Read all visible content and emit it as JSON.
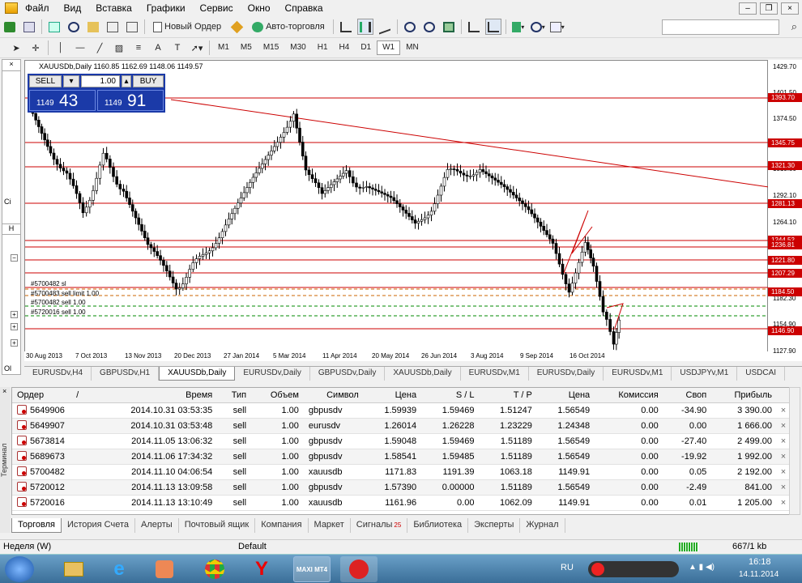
{
  "menu": [
    "Файл",
    "Вид",
    "Вставка",
    "Графики",
    "Сервис",
    "Окно",
    "Справка"
  ],
  "toolbar": {
    "new_order": "Новый Ордер",
    "auto_trading": "Авто-торговля"
  },
  "timeframes": [
    "M1",
    "M5",
    "M15",
    "M30",
    "H1",
    "H4",
    "D1",
    "W1",
    "MN"
  ],
  "chart": {
    "title": "XAUUSDb,Daily",
    "ohlc": "1160.85 1162.69 1148.06 1149.57",
    "sell_label": "SELL",
    "buy_label": "BUY",
    "lot": "1.00",
    "sell_small": "1149",
    "sell_big": "43",
    "buy_small": "1149",
    "buy_big": "91",
    "order_labels": [
      "#5700482 sl",
      "#5700483 sell limit 1.00",
      "#5700482 sell 1.00",
      "#5720016 sell 1.00"
    ],
    "price_ticks": [
      "1429.70",
      "1401.50",
      "1374.50",
      "1347.50",
      "1319.50",
      "1292.10",
      "1264.10",
      "1237.70",
      "1209.70",
      "1182.30",
      "1154.90",
      "1127.90"
    ],
    "price_tags": [
      "1393.70",
      "1345.75",
      "1321.30",
      "1281.13",
      "1244.52",
      "1236.81",
      "1221.80",
      "1207.29",
      "1184.50",
      "1146.90"
    ],
    "dates": [
      "30 Aug 2013",
      "7 Oct 2013",
      "13 Nov 2013",
      "20 Dec 2013",
      "27 Jan 2014",
      "5 Mar 2014",
      "11 Apr 2014",
      "20 May 2014",
      "26 Jun 2014",
      "3 Aug 2014",
      "9 Sep 2014",
      "16 Oct 2014"
    ],
    "colors": {
      "lines": "#cc0000",
      "tag_bg": "#cc0000",
      "panel": "#1b3aa8"
    }
  },
  "chart_tabs": [
    "EURUSDv,H4",
    "GBPUSDv,H1",
    "XAUUSDb,Daily",
    "EURUSDv,Daily",
    "GBPUSDv,Daily",
    "XAUUSDb,Daily",
    "EURUSDv,M1",
    "EURUSDv,Daily",
    "EURUSDv,M1",
    "USDJPYv,M1",
    "USDCAI"
  ],
  "terminal": {
    "headers": [
      "Ордер",
      "/",
      "Время",
      "Тип",
      "Объем",
      "Символ",
      "Цена",
      "S / L",
      "T / P",
      "Цена",
      "Комиссия",
      "Своп",
      "Прибыль"
    ],
    "rows": [
      [
        "5649906",
        "2014.10.31 03:53:35",
        "sell",
        "1.00",
        "gbpusdv",
        "1.59939",
        "1.59469",
        "1.51247",
        "1.56549",
        "0.00",
        "-34.90",
        "3 390.00"
      ],
      [
        "5649907",
        "2014.10.31 03:53:48",
        "sell",
        "1.00",
        "eurusdv",
        "1.26014",
        "1.26228",
        "1.23229",
        "1.24348",
        "0.00",
        "0.00",
        "1 666.00"
      ],
      [
        "5673814",
        "2014.11.05 13:06:32",
        "sell",
        "1.00",
        "gbpusdv",
        "1.59048",
        "1.59469",
        "1.51189",
        "1.56549",
        "0.00",
        "-27.40",
        "2 499.00"
      ],
      [
        "5689673",
        "2014.11.06 17:34:32",
        "sell",
        "1.00",
        "gbpusdv",
        "1.58541",
        "1.59485",
        "1.51189",
        "1.56549",
        "0.00",
        "-19.92",
        "1 992.00"
      ],
      [
        "5700482",
        "2014.11.10 04:06:54",
        "sell",
        "1.00",
        "xauusdb",
        "1171.83",
        "1191.39",
        "1063.18",
        "1149.91",
        "0.00",
        "0.05",
        "2 192.00"
      ],
      [
        "5720012",
        "2014.11.13 13:09:58",
        "sell",
        "1.00",
        "gbpusdv",
        "1.57390",
        "0.00000",
        "1.51189",
        "1.56549",
        "0.00",
        "-2.49",
        "841.00"
      ],
      [
        "5720016",
        "2014.11.13 13:10:49",
        "sell",
        "1.00",
        "xauusdb",
        "1161.96",
        "0.00",
        "1062.09",
        "1149.91",
        "0.00",
        "0.01",
        "1 205.00"
      ]
    ],
    "side_label": "Терминал",
    "tabs": [
      "Торговля",
      "История Счета",
      "Алерты",
      "Почтовый ящик",
      "Компания",
      "Маркет",
      "Сигналы",
      "Библиотека",
      "Эксперты",
      "Журнал"
    ],
    "signals_badge": "25"
  },
  "status": {
    "left": "Неделя (W)",
    "profile": "Default",
    "traffic": "667/1 kb"
  },
  "taskbar": {
    "lang": "RU",
    "time": "16:18",
    "date": "14.11.2014"
  },
  "left_panel": {
    "tab1": "Ci",
    "tab2": "Ol"
  }
}
